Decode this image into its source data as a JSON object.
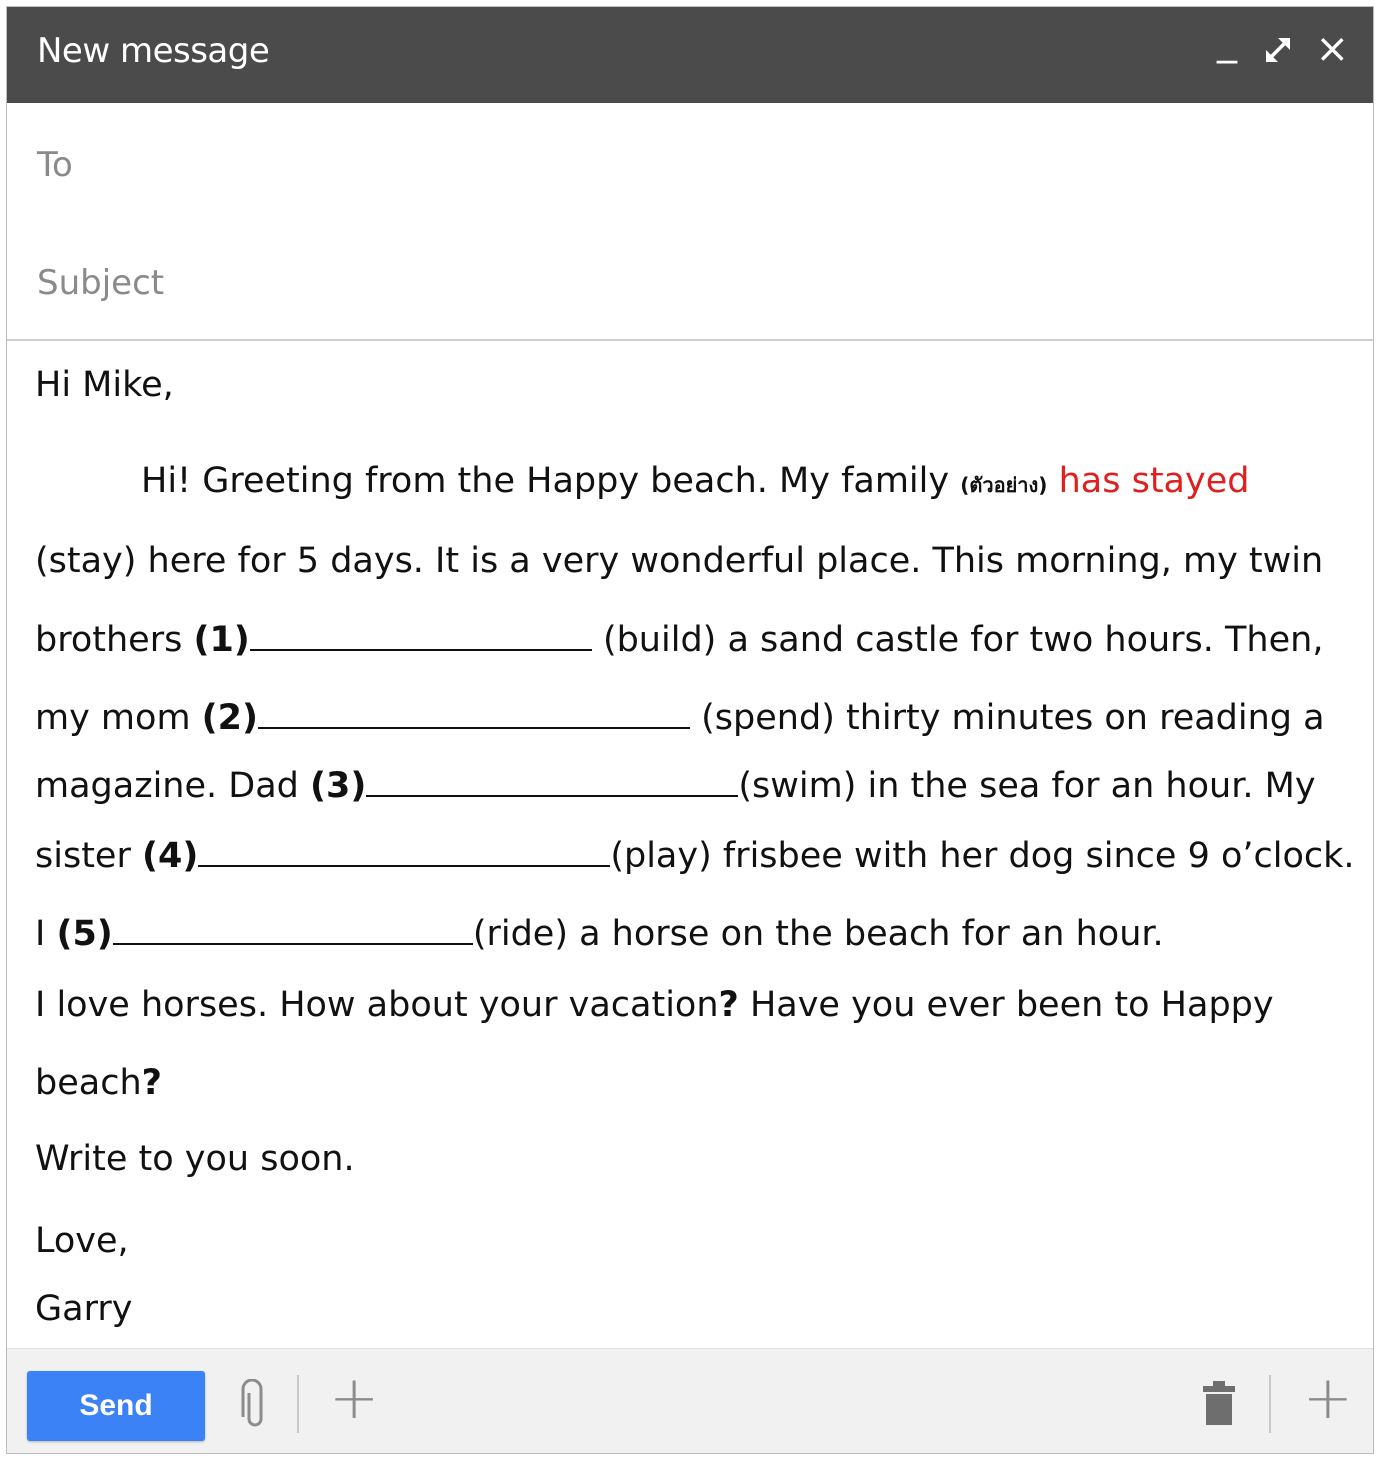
{
  "window": {
    "title": "New message",
    "minimize_glyph": "_",
    "maximize_icon": "expand-icon",
    "close_glyph": "×"
  },
  "fields": {
    "to_label": "To",
    "subject_label": "Subject"
  },
  "body": {
    "greeting": "Hi Mike,",
    "l1_a": "Hi! Greeting from the Happy beach. My family ",
    "l1_thai": "(ตัวอย่าง)",
    "l1_example": "has stayed",
    "l2": "(stay) here for 5 days. It is a very wonderful place. This morning, my twin",
    "l3_a": "brothers ",
    "l3_num": "(1)",
    "l3_b": " (build) a sand castle for two hours. Then,",
    "l4_a": "my mom ",
    "l4_num": "(2)",
    "l4_b": " (spend) thirty minutes on reading a",
    "l5_a": "magazine.  Dad ",
    "l5_num": "(3)",
    "l5_b": "(swim) in the sea for an hour. My",
    "l6_a": "sister ",
    "l6_num": "(4)",
    "l6_b": "(play) frisbee with her dog since 9 o’clock.",
    "l7_a": "I ",
    "l7_num": "(5)",
    "l7_b": "(ride) a horse on the beach for an hour.",
    "l8_a": "I love horses. How about your vacation",
    "l8_q": "?",
    "l8_b": " Have you ever been to Happy",
    "l9_a": "beach",
    "l9_q": "?",
    "l10": "Write to you soon.",
    "l11": "Love,",
    "l12": "Garry"
  },
  "footer": {
    "send_label": "Send",
    "attach_icon": "paperclip-icon",
    "plus_glyph": "+",
    "trash_icon": "trash-icon"
  },
  "colors": {
    "titlebar": "#4b4b4b",
    "send": "#3b82f6",
    "example_answer": "#e02020"
  }
}
